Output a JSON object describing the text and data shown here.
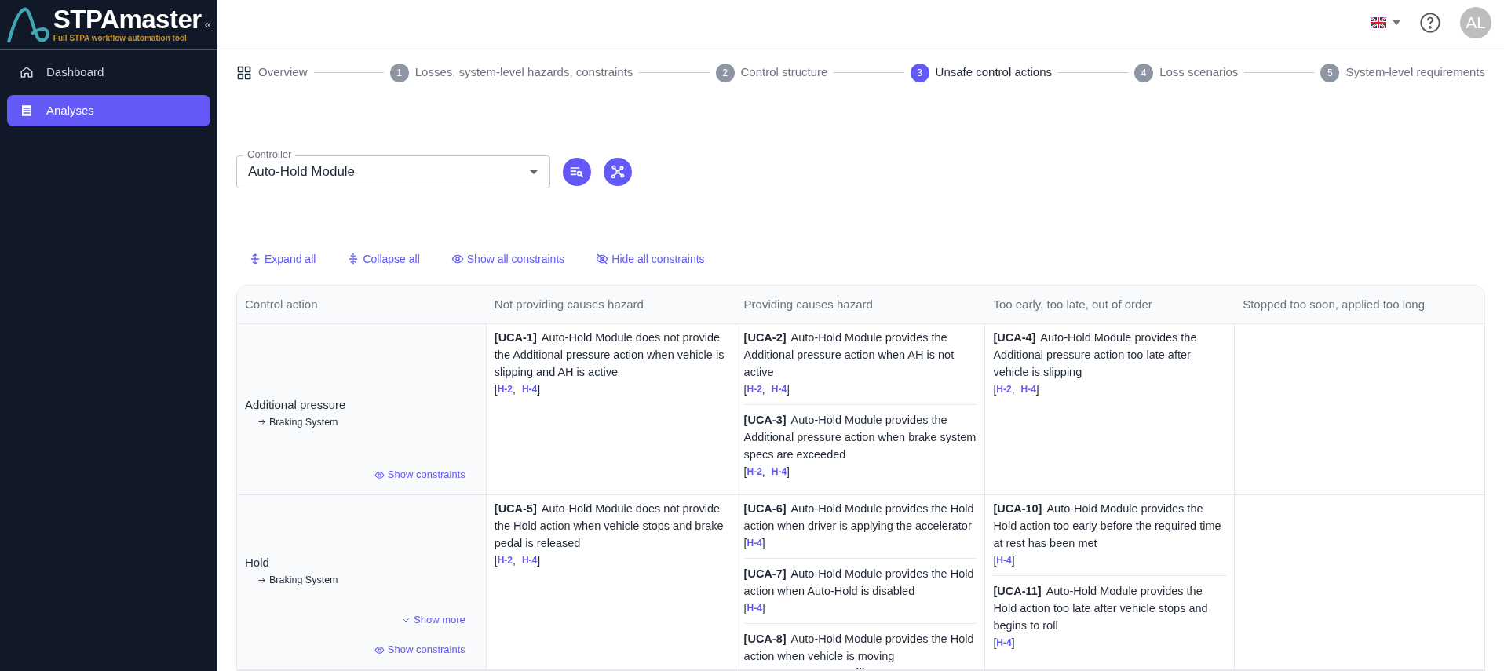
{
  "sidebar": {
    "logo": {
      "name": "STPAmaster",
      "tagline": "Full STPA workflow automation tool"
    },
    "collapse": "«",
    "items": [
      {
        "label": "Dashboard",
        "selected": false
      },
      {
        "label": "Analyses",
        "selected": true
      }
    ]
  },
  "header": {
    "avatar": "AL"
  },
  "stepper": {
    "overview": "Overview",
    "steps": [
      {
        "number": "1",
        "label": "Losses, system-level hazards, constraints",
        "selected": false
      },
      {
        "number": "2",
        "label": "Control structure",
        "selected": false
      },
      {
        "number": "3",
        "label": "Unsafe control actions",
        "selected": true
      },
      {
        "number": "4",
        "label": "Loss scenarios",
        "selected": false
      },
      {
        "number": "5",
        "label": "System-level requirements",
        "selected": false
      }
    ]
  },
  "controller": {
    "label": "Controller",
    "value": "Auto-Hold Module"
  },
  "toolbar": [
    {
      "kind": "expand",
      "label": "Expand all"
    },
    {
      "kind": "collapse",
      "label": "Collapse all"
    },
    {
      "kind": "show",
      "label": "Show all constraints"
    },
    {
      "kind": "hide",
      "label": "Hide all constraints"
    }
  ],
  "table": {
    "columns": [
      "Control action",
      "Not providing causes hazard",
      "Providing causes hazard",
      "Too early, too late, out of order",
      "Stopped too soon, applied too long"
    ],
    "rows": [
      {
        "cells": [
          {
            "action": "Additional pressure",
            "target": "Braking System",
            "links": [
              {
                "kind": "show_constraints",
                "label": "Show constraints"
              }
            ]
          },
          {
            "ucas": [
              {
                "id": "[UCA-1]",
                "text": "Auto-Hold Module does not provide the Additional pressure action when vehicle is slipping and AH is active",
                "refs": {
                  "open": "[",
                  "items": [
                    "H-2",
                    "H-4"
                  ],
                  "separator": ",",
                  "close": "]"
                }
              }
            ]
          },
          {
            "ucas": [
              {
                "id": "[UCA-2]",
                "text": "Auto-Hold Module provides the Additional pressure action when AH is not active",
                "refs": {
                  "open": "[",
                  "items": [
                    "H-2",
                    "H-4"
                  ],
                  "separator": ",",
                  "close": "]"
                }
              },
              {
                "id": "[UCA-3]",
                "text": "Auto-Hold Module provides the Additional pressure action when brake system specs are exceeded",
                "refs": {
                  "open": "[",
                  "items": [
                    "H-2",
                    "H-4"
                  ],
                  "separator": ",",
                  "close": "]"
                }
              }
            ]
          },
          {
            "ucas": [
              {
                "id": "[UCA-4]",
                "text": "Auto-Hold Module provides the Additional pressure action too late after vehicle is slipping",
                "refs": {
                  "open": "[",
                  "items": [
                    "H-2",
                    "H-4"
                  ],
                  "separator": ",",
                  "close": "]"
                }
              }
            ]
          },
          ""
        ]
      },
      {
        "cells": [
          {
            "action": "Hold",
            "target": "Braking System",
            "links": [
              {
                "kind": "show_more",
                "label": "Show more"
              },
              {
                "kind": "show_constraints",
                "label": "Show constraints"
              }
            ]
          },
          {
            "ucas": [
              {
                "id": "[UCA-5]",
                "text": "Auto-Hold Module does not provide the Hold action when vehicle stops and brake pedal is released",
                "refs": {
                  "open": "[",
                  "items": [
                    "H-2",
                    "H-4"
                  ],
                  "separator": ",",
                  "close": "]"
                }
              }
            ]
          },
          {
            "ucas": [
              {
                "id": "[UCA-6]",
                "text": "Auto-Hold Module provides the Hold action when driver is applying the accelerator",
                "refs": {
                  "open": "[",
                  "items": [
                    "H-4"
                  ],
                  "close": "]"
                }
              },
              {
                "id": "[UCA-7]",
                "text": "Auto-Hold Module provides the Hold action when Auto-Hold is disabled",
                "refs": {
                  "open": "[",
                  "items": [
                    "H-4"
                  ],
                  "close": "]"
                }
              },
              {
                "id": "[UCA-8]",
                "text": "Auto-Hold Module provides the Hold action when vehicle is moving"
              }
            ],
            "more_marker": "..."
          },
          {
            "ucas": [
              {
                "id": "[UCA-10]",
                "text": "Auto-Hold Module provides the Hold action too early before the required time at rest has been met",
                "refs": {
                  "open": "[",
                  "items": [
                    "H-4"
                  ],
                  "close": "]"
                }
              },
              {
                "id": "[UCA-11]",
                "text": "Auto-Hold Module provides the Hold action too late after vehicle stops and begins to roll",
                "refs": {
                  "open": "[",
                  "items": [
                    "H-4"
                  ],
                  "close": "]"
                }
              }
            ]
          },
          ""
        ]
      }
    ]
  }
}
